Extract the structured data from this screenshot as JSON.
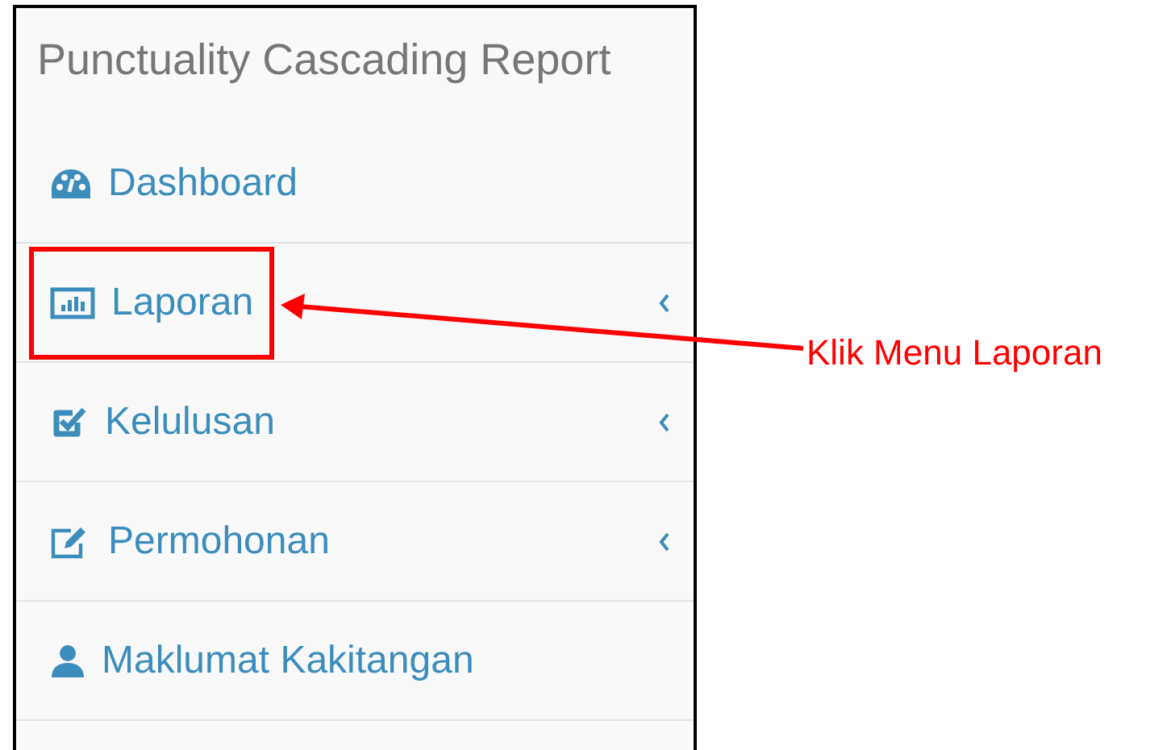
{
  "sidebar": {
    "title": "Punctuality Cascading Report",
    "items": [
      {
        "label": "Dashboard",
        "has_submenu": false,
        "annotated": false
      },
      {
        "label": "Laporan",
        "has_submenu": true,
        "annotated": true
      },
      {
        "label": "Kelulusan",
        "has_submenu": true,
        "annotated": false
      },
      {
        "label": "Permohonan",
        "has_submenu": true,
        "annotated": false
      },
      {
        "label": "Maklumat Kakitangan",
        "has_submenu": false,
        "annotated": false
      }
    ]
  },
  "annotation": {
    "text": "Klik Menu Laporan"
  }
}
